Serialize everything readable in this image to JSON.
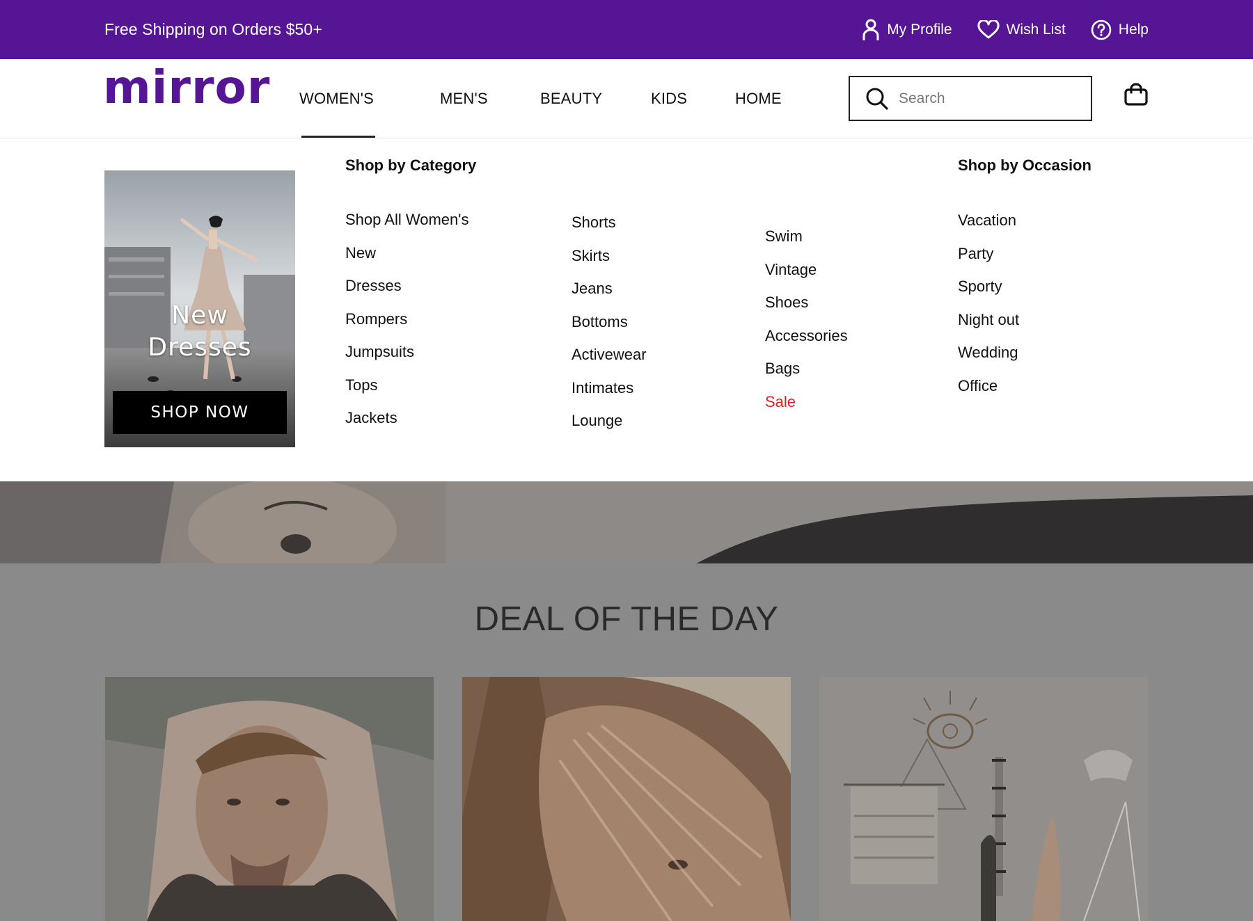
{
  "promo_bar": {
    "message": "Free Shipping on Orders $50+",
    "links": [
      {
        "label": "My Profile",
        "icon": "user-icon"
      },
      {
        "label": "Wish List",
        "icon": "heart-icon"
      },
      {
        "label": "Help",
        "icon": "help-icon"
      }
    ]
  },
  "header": {
    "logo": "mirror",
    "nav": [
      {
        "label": "WOMEN'S",
        "active": true
      },
      {
        "label": "MEN'S"
      },
      {
        "label": "BEAUTY"
      },
      {
        "label": "KIDS"
      },
      {
        "label": "HOME"
      }
    ],
    "search": {
      "placeholder": "Search",
      "value": ""
    },
    "cart_icon": "shopping-bag-icon"
  },
  "mega_menu": {
    "promo": {
      "headline_line1": "New",
      "headline_line2": "Dresses",
      "cta": "SHOP NOW"
    },
    "category_heading": "Shop by Category",
    "occasion_heading": "Shop by Occasion",
    "category_col1": [
      "Shop All Women's",
      "New",
      "Dresses",
      "Rompers",
      "Jumpsuits",
      "Tops",
      "Jackets"
    ],
    "category_col2": [
      "Shorts",
      "Skirts",
      "Jeans",
      "Bottoms",
      "Activewear",
      "Intimates",
      "Lounge"
    ],
    "category_col3": [
      "Swim",
      "Vintage",
      "Shoes",
      "Accessories",
      "Bags",
      "Sale"
    ],
    "occasion_col": [
      "Vacation",
      "Party",
      "Sporty",
      "Night out",
      "Wedding",
      "Office"
    ]
  },
  "deal": {
    "title": "DEAL OF THE DAY"
  },
  "colors": {
    "brand": "#561595",
    "sale": "#e02020",
    "overlay": "#8a8a8a"
  }
}
